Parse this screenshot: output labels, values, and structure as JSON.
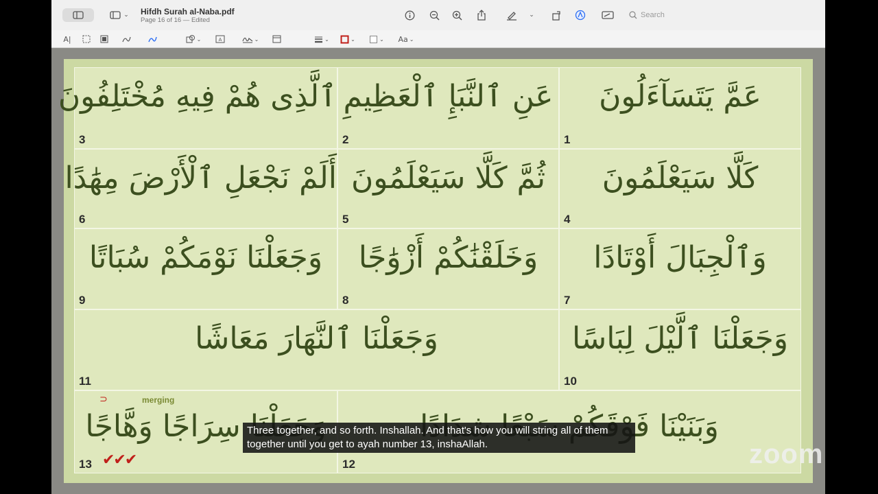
{
  "window": {
    "title": "Hifdh Surah al-Naba.pdf",
    "subtitle": "Page 16 of 16 — Edited",
    "search_placeholder": "Search"
  },
  "toolbar_icons": [
    "sidebar-icon",
    "info-icon",
    "zoom-out-icon",
    "zoom-in-icon",
    "share-icon",
    "highlight-pen-icon",
    "rotate-icon",
    "markup-icon",
    "redact-icon",
    "search-icon"
  ],
  "markup_icons": [
    "text-selection-icon",
    "rect-selection-icon",
    "redact-box-icon",
    "sketch-icon",
    "draw-icon",
    "shapes-icon",
    "text-box-icon",
    "sign-icon",
    "note-icon",
    "line-style-icon",
    "border-color-icon",
    "fill-color-icon",
    "text-style-icon"
  ],
  "markup_text_style_label": "Aa",
  "ayat": [
    {
      "num": "1",
      "text": "عَمَّ يَتَسَآءَلُونَ"
    },
    {
      "num": "2",
      "text": "عَنِ ٱلنَّبَإِ ٱلْعَظِيمِ"
    },
    {
      "num": "3",
      "text": "ٱلَّذِى هُمْ فِيهِ مُخْتَلِفُونَ"
    },
    {
      "num": "4",
      "text": "كَلَّا سَيَعْلَمُونَ"
    },
    {
      "num": "5",
      "text": "ثُمَّ كَلَّا سَيَعْلَمُونَ"
    },
    {
      "num": "6",
      "text": "أَلَمْ نَجْعَلِ ٱلْأَرْضَ مِهَٰدًا"
    },
    {
      "num": "7",
      "text": "وَٱلْجِبَالَ أَوْتَادًا"
    },
    {
      "num": "8",
      "text": "وَخَلَقْنَٰكُمْ أَزْوَٰجًا"
    },
    {
      "num": "9",
      "text": "وَجَعَلْنَا نَوْمَكُمْ سُبَاتًا"
    },
    {
      "num": "10",
      "text": "وَجَعَلْنَا ٱلَّيْلَ لِبَاسًا"
    },
    {
      "num": "11",
      "text": "وَجَعَلْنَا ٱلنَّهَارَ مَعَاشًا"
    },
    {
      "num": "12",
      "text": "وَبَنَيْنَا فَوْقَكُمْ سَبْعًا شِدَادًا"
    },
    {
      "num": "13",
      "text": "وَجَعَلْنَا سِرَاجًا وَهَّاجًا"
    }
  ],
  "annotation": {
    "merging_label": "merging",
    "checks": "✔✔✔",
    "arrow": "⊃"
  },
  "caption": "Three together, and so forth. Inshallah. And that's how you will string all of them together until you get to ayah number 13, inshaAllah.",
  "watermark": "zoom"
}
